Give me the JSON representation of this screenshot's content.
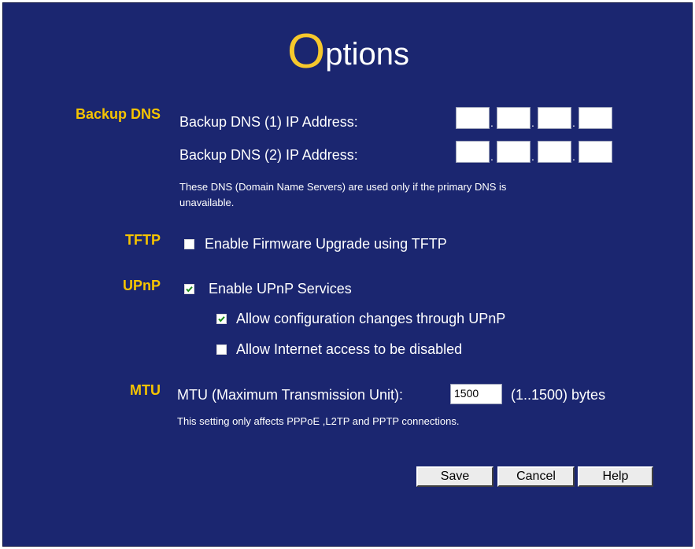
{
  "title": {
    "first_letter": "O",
    "rest": "ptions"
  },
  "backup_dns": {
    "section_label": "Backup DNS",
    "dns1_label": "Backup DNS (1) IP Address:",
    "dns2_label": "Backup DNS (2) IP Address:",
    "dns1_octets": [
      "",
      "",
      "",
      ""
    ],
    "dns2_octets": [
      "",
      "",
      "",
      ""
    ],
    "note_line1": "These DNS (Domain Name Servers) are used only if the primary DNS is",
    "note_line2": "unavailable."
  },
  "tftp": {
    "section_label": "TFTP",
    "enable_label": "Enable Firmware Upgrade using TFTP",
    "enable_checked": false
  },
  "upnp": {
    "section_label": "UPnP",
    "enable_label": "Enable UPnP Services",
    "enable_checked": true,
    "allow_config_label": "Allow configuration changes through UPnP",
    "allow_config_checked": true,
    "allow_disable_label": "Allow Internet access to be disabled",
    "allow_disable_checked": false
  },
  "mtu": {
    "section_label": "MTU",
    "field_label": "MTU (Maximum Transmission Unit):",
    "value": "1500",
    "range_label": "(1..1500) bytes",
    "note": "This setting only affects PPPoE ,L2TP and PPTP connections."
  },
  "buttons": {
    "save": "Save",
    "cancel": "Cancel",
    "help": "Help"
  },
  "colors": {
    "background": "#1b2670",
    "accent": "#f6c400",
    "text": "#ffffff"
  }
}
